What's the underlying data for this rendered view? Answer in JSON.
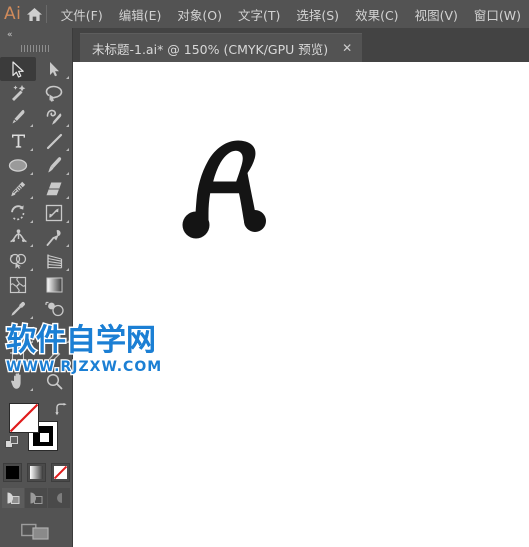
{
  "app": {
    "name": "Ai",
    "logo_color": "#d08b5b",
    "ui_bg": "#535353",
    "tabbar_bg": "#434343",
    "canvas_bg": "#ffffff"
  },
  "menubar": {
    "logo_label": "Ai",
    "home_icon": "home-icon",
    "items": [
      {
        "label": "文件(F)",
        "name": "menu-file"
      },
      {
        "label": "编辑(E)",
        "name": "menu-edit"
      },
      {
        "label": "对象(O)",
        "name": "menu-object"
      },
      {
        "label": "文字(T)",
        "name": "menu-type"
      },
      {
        "label": "选择(S)",
        "name": "menu-select"
      },
      {
        "label": "效果(C)",
        "name": "menu-effect"
      },
      {
        "label": "视图(V)",
        "name": "menu-view"
      },
      {
        "label": "窗口(W)",
        "name": "menu-window"
      }
    ]
  },
  "tabbar": {
    "tabs": [
      {
        "title": "未标题-1.ai* @ 150% (CMYK/GPU 预览)",
        "close_label": "✕",
        "active": true
      }
    ]
  },
  "toolbar": {
    "collapse_label": "«",
    "tools": [
      {
        "name": "selection-tool",
        "label": "选择工具",
        "active": true,
        "corner": false
      },
      {
        "name": "direct-selection-tool",
        "label": "直接选择工具",
        "active": false,
        "corner": true
      },
      {
        "name": "magic-wand-tool",
        "label": "魔棒工具",
        "active": false,
        "corner": false
      },
      {
        "name": "lasso-tool",
        "label": "套索工具",
        "active": false,
        "corner": false
      },
      {
        "name": "pen-tool",
        "label": "钢笔工具",
        "active": false,
        "corner": true
      },
      {
        "name": "curvature-tool",
        "label": "曲率工具",
        "active": false,
        "corner": true
      },
      {
        "name": "type-tool",
        "label": "文字工具",
        "active": false,
        "corner": true
      },
      {
        "name": "line-segment-tool",
        "label": "直线段工具",
        "active": false,
        "corner": true
      },
      {
        "name": "ellipse-tool",
        "label": "椭圆工具",
        "active": false,
        "corner": true
      },
      {
        "name": "paintbrush-tool",
        "label": "画笔工具",
        "active": false,
        "corner": true
      },
      {
        "name": "pencil-tool",
        "label": "铅笔工具",
        "active": false,
        "corner": true
      },
      {
        "name": "eraser-tool",
        "label": "橡皮擦工具",
        "active": false,
        "corner": true
      },
      {
        "name": "rotate-tool",
        "label": "旋转工具",
        "active": false,
        "corner": true
      },
      {
        "name": "scale-tool",
        "label": "比例缩放工具",
        "active": false,
        "corner": true
      },
      {
        "name": "width-tool",
        "label": "宽度工具",
        "active": false,
        "corner": true
      },
      {
        "name": "free-transform-tool",
        "label": "自由变换工具",
        "active": false,
        "corner": true
      },
      {
        "name": "shape-builder-tool",
        "label": "形状生成器工具",
        "active": false,
        "corner": true
      },
      {
        "name": "perspective-grid-tool",
        "label": "透视网格工具",
        "active": false,
        "corner": true
      },
      {
        "name": "mesh-tool",
        "label": "网格工具",
        "active": false,
        "corner": false
      },
      {
        "name": "gradient-tool",
        "label": "渐变工具",
        "active": false,
        "corner": false
      },
      {
        "name": "eyedropper-tool",
        "label": "吸管工具",
        "active": false,
        "corner": true
      },
      {
        "name": "blend-tool",
        "label": "混合工具",
        "active": false,
        "corner": false
      },
      {
        "name": "symbol-sprayer-tool",
        "label": "符号喷枪工具",
        "active": false,
        "corner": true
      },
      {
        "name": "column-graph-tool",
        "label": "柱形图工具",
        "active": false,
        "corner": true
      },
      {
        "name": "artboard-tool",
        "label": "画板工具",
        "active": false,
        "corner": false
      },
      {
        "name": "slice-tool",
        "label": "切片工具",
        "active": false,
        "corner": true
      },
      {
        "name": "hand-tool",
        "label": "抓手工具",
        "active": false,
        "corner": true
      },
      {
        "name": "zoom-tool",
        "label": "缩放工具",
        "active": false,
        "corner": false
      }
    ],
    "fill": {
      "label": "填色",
      "value": "无",
      "color": "#ffffff",
      "none": true
    },
    "stroke": {
      "label": "描边",
      "value": "黑色",
      "color": "#000000",
      "none": false
    },
    "swap_label": "互换填色和描边",
    "default_label": "默认填色和描边",
    "modes": [
      {
        "name": "color-mode-button",
        "label": "颜色",
        "selected": false
      },
      {
        "name": "gradient-mode-button",
        "label": "渐变",
        "selected": false
      },
      {
        "name": "none-mode-button",
        "label": "无",
        "selected": true
      }
    ],
    "draw_modes": [
      {
        "name": "draw-normal-button",
        "label": "正常绘图",
        "selected": true
      },
      {
        "name": "draw-behind-button",
        "label": "背面绘图",
        "selected": false
      },
      {
        "name": "draw-inside-button",
        "label": "内部绘图",
        "selected": false
      }
    ],
    "screen_mode_label": "更改屏幕模式"
  },
  "canvas": {
    "artwork_name": "letter-a-glyph",
    "artwork_color": "#141414",
    "zoom_level": "150%"
  },
  "watermark": {
    "main": "软件自学网",
    "sub": "WWW.RJZXW.COM",
    "color": "#1b7fd4"
  }
}
